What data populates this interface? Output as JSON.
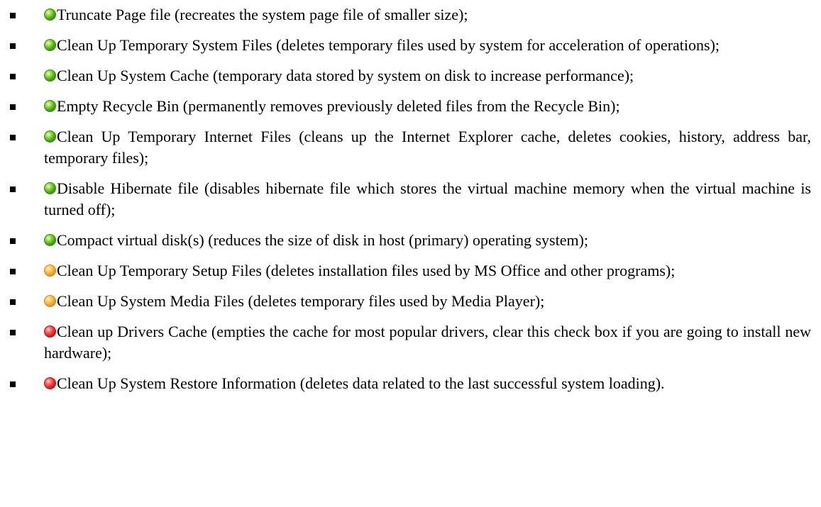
{
  "items": [
    {
      "status": "green",
      "status_icon": "green-status-icon",
      "text": "Truncate Page file (recreates the system page file of smaller size);"
    },
    {
      "status": "green",
      "status_icon": "green-status-icon",
      "text": "Clean Up Temporary System Files (deletes temporary files used by system for acceleration of operations);"
    },
    {
      "status": "green",
      "status_icon": "green-status-icon",
      "text": "Clean Up System Cache (temporary data stored by system on disk to increase performance);"
    },
    {
      "status": "green",
      "status_icon": "green-status-icon",
      "text": "Empty Recycle Bin (permanently removes previously deleted files from the Recycle Bin);"
    },
    {
      "status": "green",
      "status_icon": "green-status-icon",
      "text": "Clean Up Temporary Internet Files (cleans up the Internet Explorer cache, deletes cookies, history, address bar, temporary files);"
    },
    {
      "status": "green",
      "status_icon": "green-status-icon",
      "text": "Disable Hibernate file (disables hibernate file which stores the virtual machine memory when the virtual machine is turned off);"
    },
    {
      "status": "green",
      "status_icon": "green-status-icon",
      "text": "Compact virtual disk(s) (reduces the size of disk in host (primary) operating system);"
    },
    {
      "status": "orange",
      "status_icon": "orange-status-icon",
      "text": "Clean Up Temporary Setup Files (deletes installation files used by MS Office and other programs);"
    },
    {
      "status": "orange",
      "status_icon": "orange-status-icon",
      "text": "Clean Up System Media Files (deletes temporary files used by Media Player);"
    },
    {
      "status": "red",
      "status_icon": "red-status-icon",
      "text": "Clean up Drivers Cache (empties the cache for most popular drivers, clear this check box if you are going to install new hardware);"
    },
    {
      "status": "red",
      "status_icon": "red-status-icon",
      "text": "Clean Up System Restore Information (deletes data related to the last successful system loading)."
    }
  ],
  "colors": {
    "green": "#47a418",
    "orange": "#f0a030",
    "red": "#e02222",
    "text": "#000000"
  }
}
